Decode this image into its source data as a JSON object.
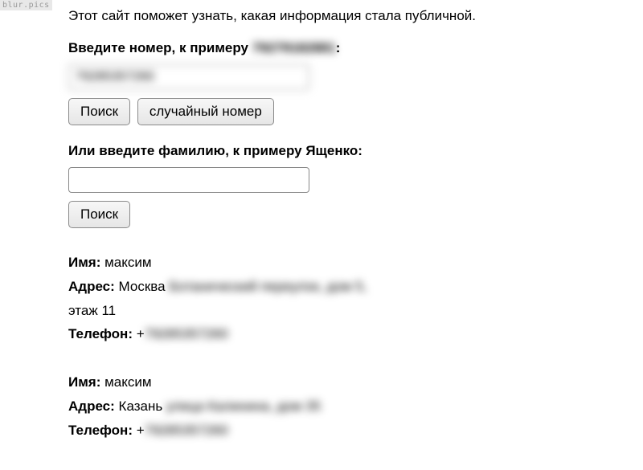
{
  "watermark": "blur.pics",
  "intro": "Этот сайт поможет узнать, какая информация стала публичной.",
  "phoneForm": {
    "labelPrefix": "Введите номер, к примеру ",
    "labelExample": "79279182881",
    "labelSuffix": ":",
    "value": "79285357260",
    "searchLabel": "Поиск",
    "randomLabel": "случайный номер"
  },
  "nameForm": {
    "label": "Или введите фамилию, к примеру Ященко:",
    "value": "",
    "searchLabel": "Поиск"
  },
  "labels": {
    "name": "Имя:",
    "address": "Адрес:",
    "phone": "Телефон:"
  },
  "results": [
    {
      "name": "максим",
      "addressCity": "Москва",
      "addressRest": "Ботанический переулок, дом 5,",
      "addressLine2": "этаж 11",
      "phonePrefix": "+",
      "phoneRest": "79285357260"
    },
    {
      "name": "максим",
      "addressCity": "Казань",
      "addressRest": "улица Калинина, дом 35",
      "addressLine2": "",
      "phonePrefix": "+",
      "phoneRest": "79285357260"
    }
  ]
}
